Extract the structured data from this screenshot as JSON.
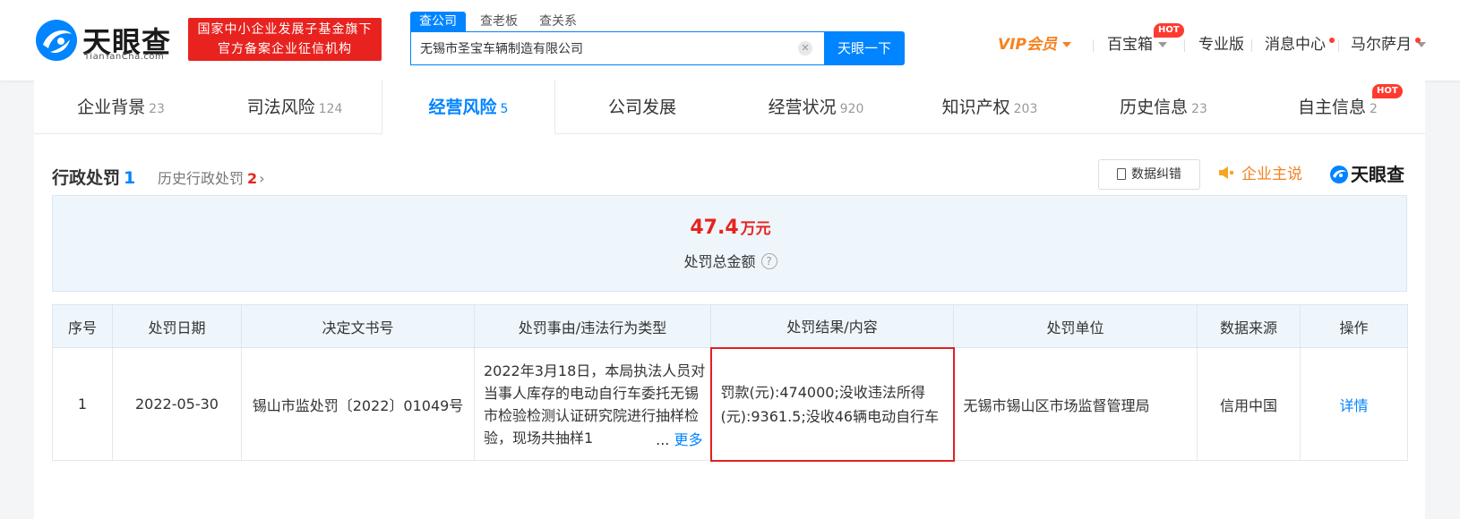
{
  "header": {
    "logo_cn": "天眼查",
    "logo_en": "TianYanCha.com",
    "slogan_line1": "国家中小企业发展子基金旗下",
    "slogan_line2": "官方备案企业征信机构",
    "search_tabs": [
      {
        "label": "查公司",
        "active": true
      },
      {
        "label": "查老板",
        "active": false
      },
      {
        "label": "查关系",
        "active": false
      }
    ],
    "search_value": "无锡市圣宝车辆制造有限公司",
    "search_button": "天眼一下",
    "nav": {
      "vip": "VIP会员",
      "treasure": "百宝箱",
      "hot": "HOT",
      "pro": "专业版",
      "messages": "消息中心",
      "user": "马尔萨月"
    }
  },
  "tabs": [
    {
      "label": "企业背景",
      "count": "23",
      "active": false
    },
    {
      "label": "司法风险",
      "count": "124",
      "active": false
    },
    {
      "label": "经营风险",
      "count": "5",
      "active": true
    },
    {
      "label": "公司发展",
      "count": "",
      "active": false
    },
    {
      "label": "经营状况",
      "count": "920",
      "active": false
    },
    {
      "label": "知识产权",
      "count": "203",
      "active": false
    },
    {
      "label": "历史信息",
      "count": "23",
      "active": false
    },
    {
      "label": "自主信息",
      "count": "2",
      "active": false,
      "hot": "HOT"
    }
  ],
  "section": {
    "title": "行政处罚",
    "count": "1",
    "history_label": "历史行政处罚",
    "history_count": "2",
    "history_chevron": "›",
    "correct_button": "数据纠错",
    "speak_button": "企业主说",
    "brand": "天眼查"
  },
  "summary": {
    "amount": "47.4",
    "unit": "万元",
    "label": "处罚总金额",
    "help": "?"
  },
  "table": {
    "headers": [
      "序号",
      "处罚日期",
      "决定文书号",
      "处罚事由/违法行为类型",
      "处罚结果/内容",
      "处罚单位",
      "数据来源",
      "操作"
    ],
    "rows": [
      {
        "index": "1",
        "date": "2022-05-30",
        "doc_no": "锡山市监处罚〔2022〕01049号",
        "reason": "2022年3月18日，本局执法人员对当事人库存的电动自行车委托无锡市检验检测认证研究院进行抽样检验，现场共抽样1",
        "more_ellipsis": "...",
        "more_label": "更多",
        "result": "罚款(元):474000;没收违法所得(元):9361.5;没收46辆电动自行车",
        "unit": "无锡市锡山区市场监督管理局",
        "source": "信用中国",
        "action": "详情"
      }
    ]
  },
  "colors": {
    "brand_blue": "#0084ff",
    "accent_red": "#e8231f",
    "vip_orange": "#f58220"
  }
}
